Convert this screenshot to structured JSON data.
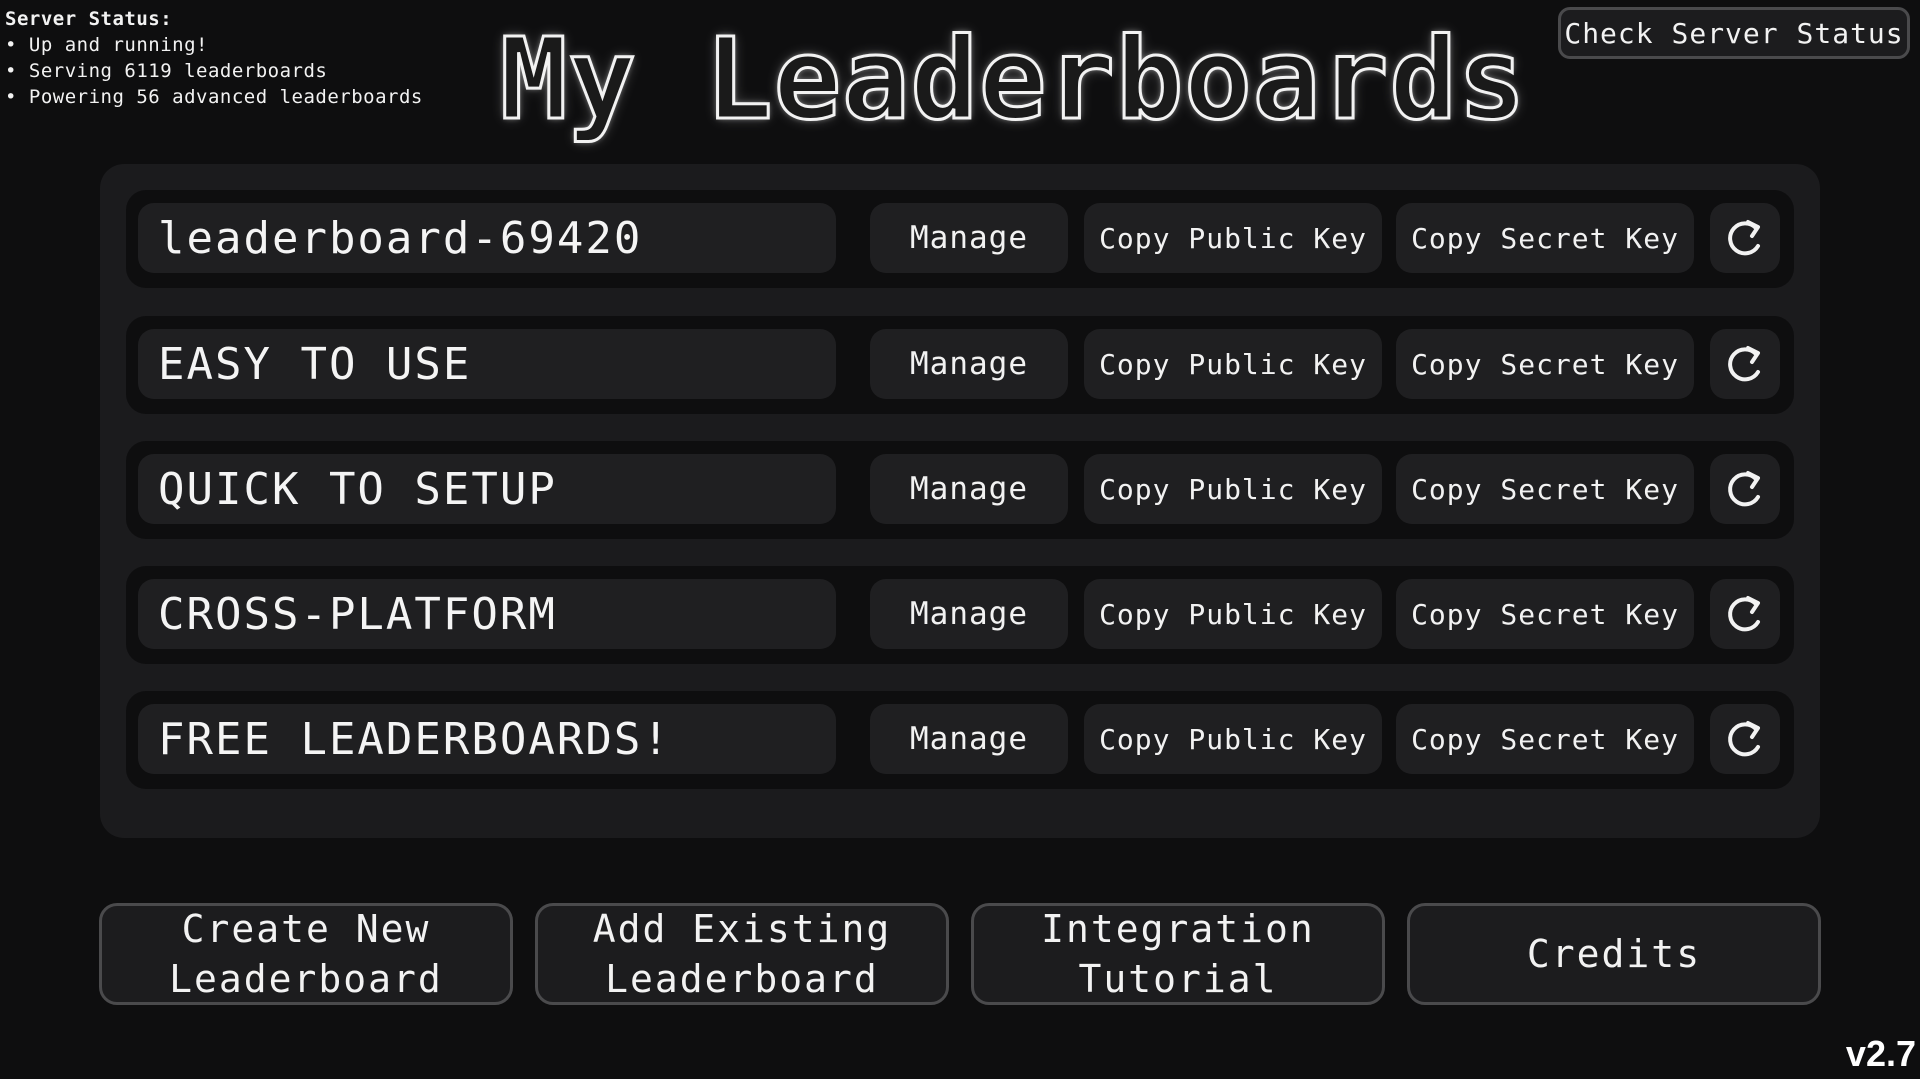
{
  "server_status": {
    "title": "Server Status:",
    "lines": [
      "• Up and running!",
      "• Serving 6119 leaderboards",
      "• Powering 56 advanced leaderboards"
    ]
  },
  "header": {
    "title": "My Leaderboards",
    "check_status_label": "Check Server Status"
  },
  "leaderboards": [
    {
      "name": "leaderboard-69420"
    },
    {
      "name": "EASY TO USE"
    },
    {
      "name": "QUICK TO SETUP"
    },
    {
      "name": "CROSS-PLATFORM"
    },
    {
      "name": "FREE LEADERBOARDS!"
    }
  ],
  "row_actions": {
    "manage_label": "Manage",
    "copy_public_label": "Copy Public Key",
    "copy_secret_label": "Copy Secret Key",
    "refresh_icon": "refresh-icon"
  },
  "bottom_buttons": {
    "create": {
      "line1": "Create New",
      "line2": "Leaderboard"
    },
    "add_existing": {
      "line1": "Add Existing",
      "line2": "Leaderboard"
    },
    "tutorial": {
      "line1": "Integration",
      "line2": "Tutorial"
    },
    "credits": {
      "line1": "Credits"
    }
  },
  "version": "v2.7",
  "colors": {
    "background": "#0e0e0f",
    "panel": "#1b1b1d",
    "button": "#1f1f21",
    "border": "#4a4a4c",
    "text": "#f2f2f2"
  }
}
